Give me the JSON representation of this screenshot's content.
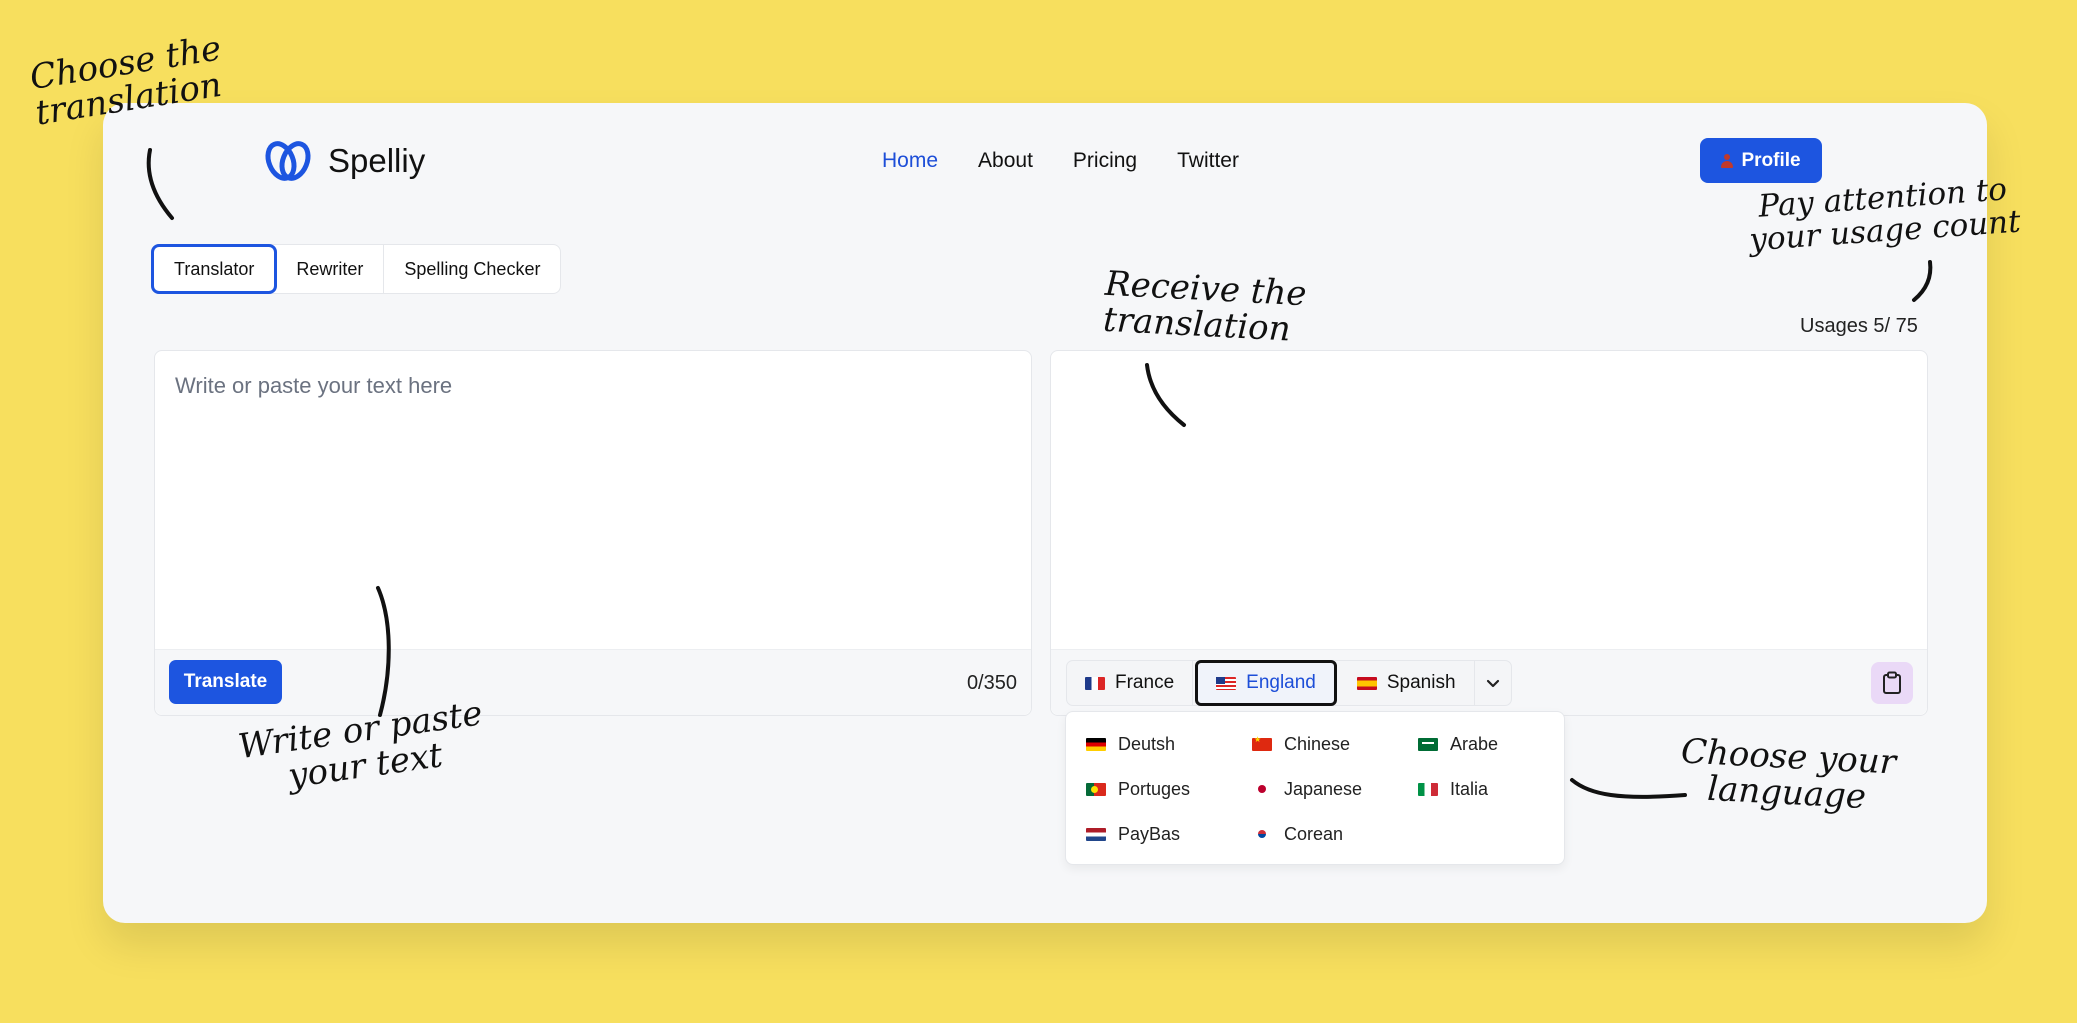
{
  "app": {
    "name": "Spelliy"
  },
  "nav": {
    "items": [
      "Home",
      "About",
      "Pricing",
      "Twitter"
    ],
    "active": "Home"
  },
  "profile_button": {
    "label": "Profile"
  },
  "tabs": {
    "items": [
      "Translator",
      "Rewriter",
      "Spelling Checker"
    ],
    "active": "Translator"
  },
  "usage": {
    "label": "Usages 5/ 75"
  },
  "input_panel": {
    "placeholder": "Write or paste your text here",
    "translate_button": "Translate",
    "counter": "0/350"
  },
  "output_panel": {
    "languages": [
      {
        "label": "France",
        "flag": "fr"
      },
      {
        "label": "England",
        "flag": "us"
      },
      {
        "label": "Spanish",
        "flag": "es"
      }
    ],
    "active_language": "England",
    "copy_icon": "clipboard-icon"
  },
  "language_dropdown": {
    "items": [
      {
        "label": "Deutsh",
        "flag": "de"
      },
      {
        "label": "Chinese",
        "flag": "cn"
      },
      {
        "label": "Arabe",
        "flag": "sa"
      },
      {
        "label": "Portuges",
        "flag": "pt"
      },
      {
        "label": "Japanese",
        "flag": "jp"
      },
      {
        "label": "Italia",
        "flag": "it"
      },
      {
        "label": "PayBas",
        "flag": "nl"
      },
      {
        "label": "Corean",
        "flag": "kr"
      }
    ]
  },
  "annotations": {
    "choose_translation": [
      "Choose the",
      "translation"
    ],
    "usage_count": [
      "Pay attention to",
      "your usage count"
    ],
    "receive_translation": [
      "Receive the",
      "translation"
    ],
    "write_text": [
      "Write or paste",
      "your text"
    ],
    "choose_language": [
      "Choose your",
      "language"
    ]
  },
  "colors": {
    "background": "#f7df5e",
    "accent": "#1d55e0",
    "card": "#f6f7f9"
  }
}
